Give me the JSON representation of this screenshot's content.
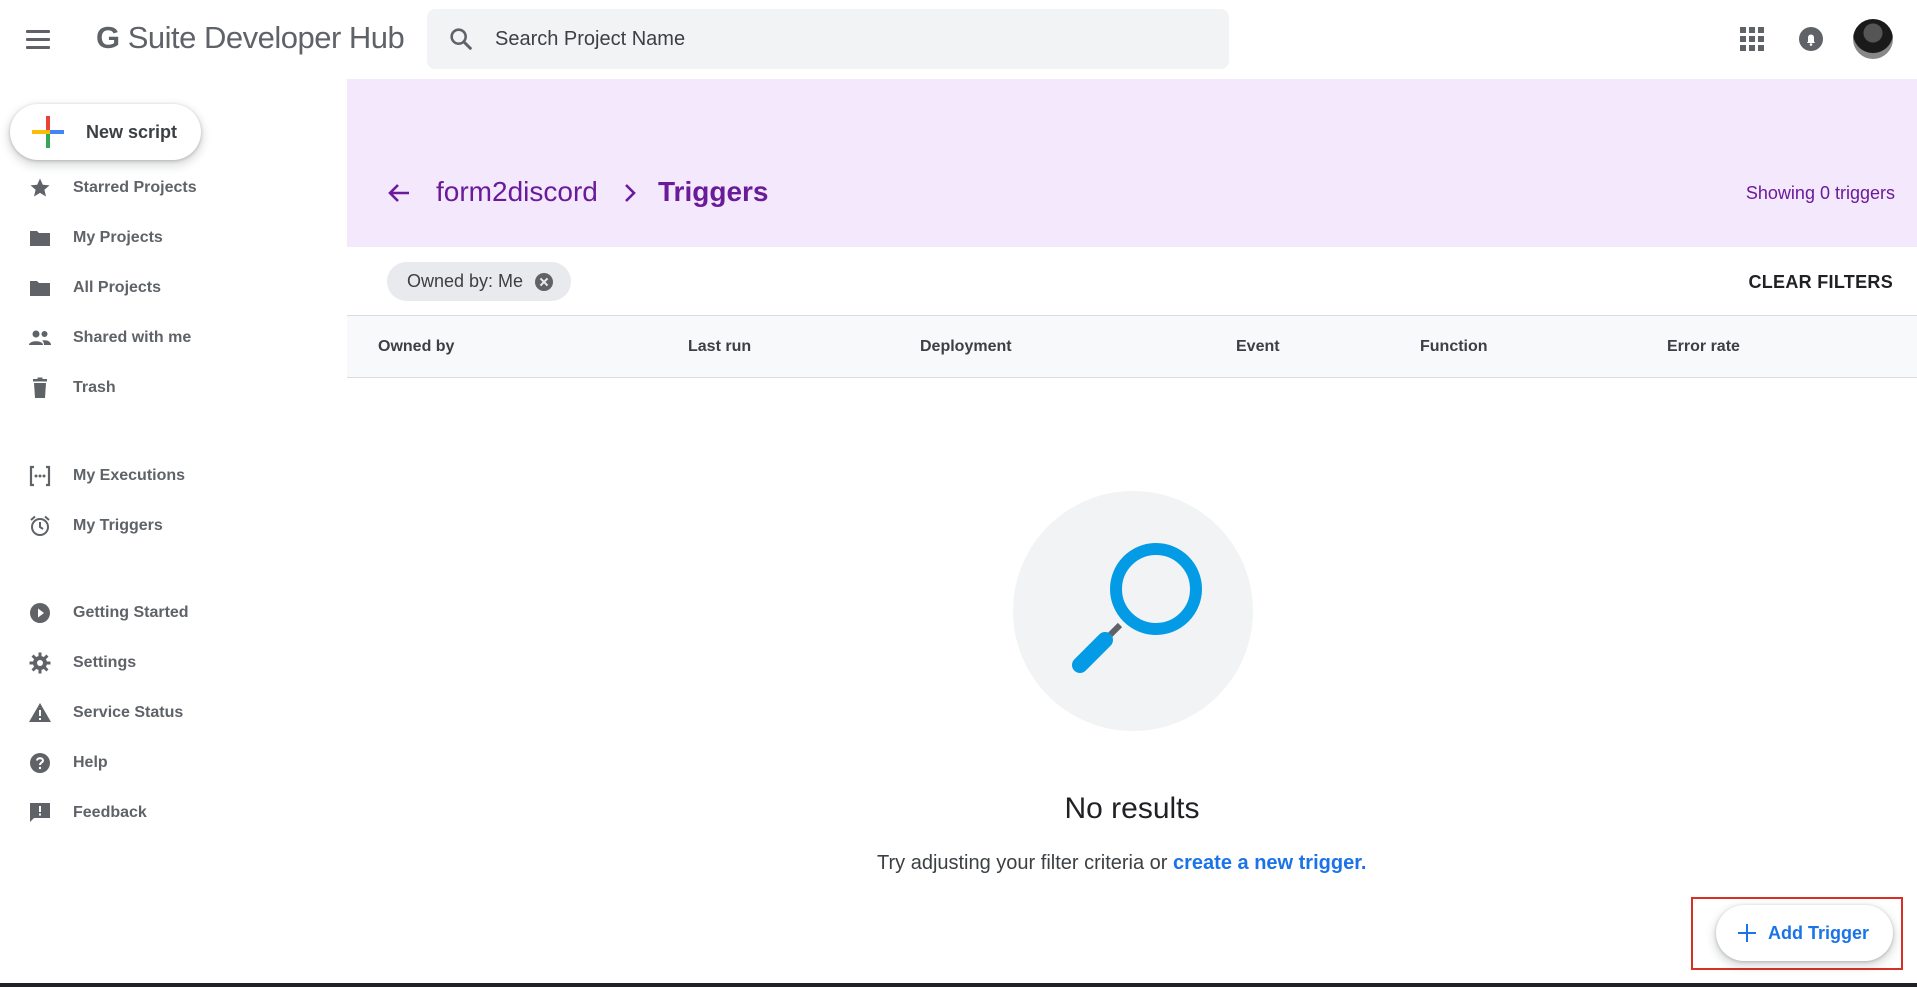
{
  "topbar": {
    "app_title_prefix": "G",
    "app_title_rest": " Suite Developer Hub",
    "search_placeholder": "Search Project Name",
    "icons": [
      "menu-icon",
      "search-icon",
      "apps-grid-icon",
      "bell-icon",
      "avatar"
    ]
  },
  "sidebar": {
    "new_script_label": "New script",
    "items": [
      {
        "label": "Starred Projects",
        "icon": "star-icon"
      },
      {
        "label": "My Projects",
        "icon": "folder-icon"
      },
      {
        "label": "All Projects",
        "icon": "folder-icon"
      },
      {
        "label": "Shared with me",
        "icon": "people-icon"
      },
      {
        "label": "Trash",
        "icon": "trash-icon"
      },
      {
        "label": "My Executions",
        "icon": "executions-icon"
      },
      {
        "label": "My Triggers",
        "icon": "alarm-icon"
      },
      {
        "label": "Getting Started",
        "icon": "play-circle-icon"
      },
      {
        "label": "Settings",
        "icon": "gear-icon"
      },
      {
        "label": "Service Status",
        "icon": "warning-icon"
      },
      {
        "label": "Help",
        "icon": "help-icon"
      },
      {
        "label": "Feedback",
        "icon": "feedback-icon"
      }
    ]
  },
  "header": {
    "project_name": "form2discord",
    "current_page": "Triggers",
    "showing_text": "Showing 0 triggers"
  },
  "filters": {
    "chip_label": "Owned by: Me",
    "clear_label": "CLEAR FILTERS"
  },
  "table": {
    "columns": [
      "Owned by",
      "Last run",
      "Deployment",
      "Event",
      "Function",
      "Error rate"
    ]
  },
  "empty_state": {
    "title": "No results",
    "message_prefix": "Try adjusting your filter criteria or ",
    "link_text": "create a new trigger."
  },
  "fab": {
    "label": "Add Trigger"
  },
  "colors": {
    "accent_purple": "#6a1b9a",
    "header_band": "#f3e8fc",
    "link_blue": "#1a73e8",
    "magnifier_blue": "#039be5",
    "highlight_red": "#d93025"
  }
}
